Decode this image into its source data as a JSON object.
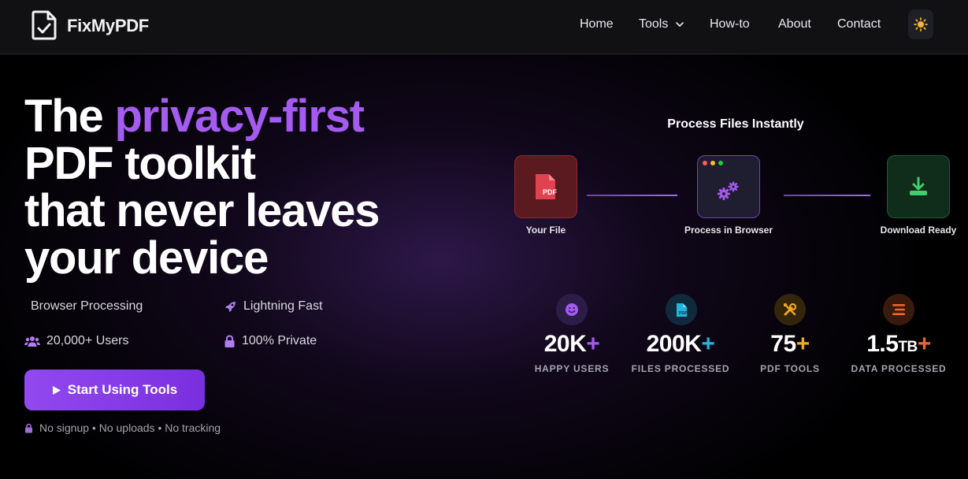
{
  "brand": {
    "name": "FixMyPDF",
    "logo_icon": "document-check-icon"
  },
  "nav": {
    "items": [
      "Home",
      "Tools",
      "How-to",
      "About",
      "Contact"
    ],
    "theme_toggle_icon": "sun-icon"
  },
  "hero": {
    "line1_prefix": "The ",
    "line1_accent": "privacy-first",
    "line2": "PDF toolkit",
    "line3": "that never leaves",
    "line4": "your device",
    "accent_color": "#a35bf0"
  },
  "features": [
    {
      "label": "Browser Processing",
      "icon": ""
    },
    {
      "label": "Lightning Fast",
      "icon": "rocket-icon"
    },
    {
      "label": "20,000+ Users",
      "icon": "users-icon"
    },
    {
      "label": "100% Private",
      "icon": "lock-icon"
    }
  ],
  "cta": {
    "label": "Start Using Tools",
    "icon": "play-icon"
  },
  "note": "No signup • No uploads • No tracking",
  "process": {
    "title": "Process Files Instantly",
    "steps": [
      {
        "label": "Your File",
        "icon": "pdf-file-icon",
        "color": "#e0434f"
      },
      {
        "label": "Process in Browser",
        "icon": "gears-icon",
        "color": "#a35bf0"
      },
      {
        "label": "Download Ready",
        "icon": "download-icon",
        "color": "#3ecf6e"
      }
    ]
  },
  "stats": [
    {
      "value": "20K",
      "unit": "",
      "plus": "+",
      "label": "HAPPY USERS",
      "icon": "smiley-icon",
      "color": "#a35bf0"
    },
    {
      "value": "200K",
      "unit": "",
      "plus": "+",
      "label": "FILES PROCESSED",
      "icon": "pdf-file-icon",
      "color": "#22b5e0"
    },
    {
      "value": "75",
      "unit": "",
      "plus": "+",
      "label": "PDF TOOLS",
      "icon": "tools-icon",
      "color": "#f0a81e"
    },
    {
      "value": "1.5",
      "unit": "TB",
      "plus": "+",
      "label": "DATA PROCESSED",
      "icon": "stack-icon",
      "color": "#f0662b"
    }
  ]
}
